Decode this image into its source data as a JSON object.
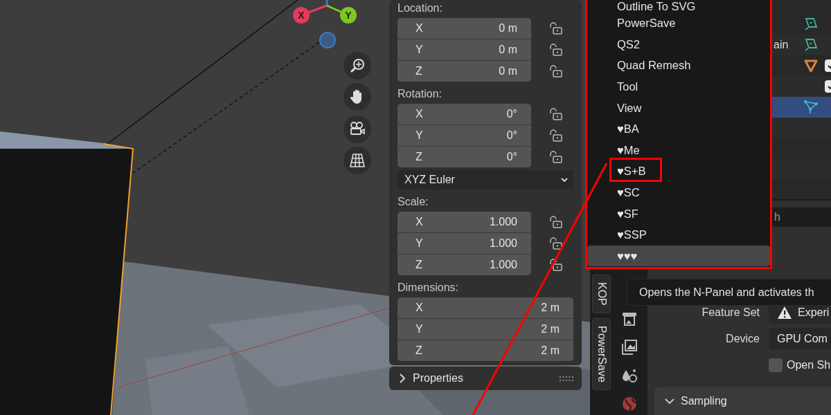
{
  "viewport": {
    "gizmo_axes": [
      {
        "label": "X",
        "color": "#e8395a"
      },
      {
        "label": "Y",
        "color": "#7dc81e"
      }
    ],
    "sidebar_tabs": [
      {
        "label": "KOP",
        "selected": false
      },
      {
        "label": "PowerSave",
        "selected": false
      }
    ]
  },
  "n_panel": {
    "sections": [
      {
        "kind": "vector",
        "label": "Location:",
        "locks": true,
        "fields": [
          {
            "axis": "X",
            "value": "0 m"
          },
          {
            "axis": "Y",
            "value": "0 m"
          },
          {
            "axis": "Z",
            "value": "0 m"
          }
        ]
      },
      {
        "kind": "vector",
        "label": "Rotation:",
        "locks": true,
        "fields": [
          {
            "axis": "X",
            "value": "0°"
          },
          {
            "axis": "Y",
            "value": "0°"
          },
          {
            "axis": "Z",
            "value": "0°"
          }
        ]
      },
      {
        "kind": "dropdown",
        "value": "XYZ Euler"
      },
      {
        "kind": "vector",
        "label": "Scale:",
        "locks": true,
        "fields": [
          {
            "axis": "X",
            "value": "1.000"
          },
          {
            "axis": "Y",
            "value": "1.000"
          },
          {
            "axis": "Z",
            "value": "1.000"
          }
        ]
      },
      {
        "kind": "vector",
        "label": "Dimensions:",
        "locks": false,
        "fields": [
          {
            "axis": "X",
            "value": "2 m"
          },
          {
            "axis": "Y",
            "value": "2 m"
          },
          {
            "axis": "Z",
            "value": "2 m"
          }
        ]
      }
    ],
    "properties_panel": {
      "label": "Properties",
      "expanded": false
    }
  },
  "menu": {
    "items": [
      {
        "label": "Outline To SVG",
        "selected": false
      },
      {
        "label": "PowerSave",
        "selected": false
      },
      {
        "label": "QS2",
        "selected": false
      },
      {
        "label": "Quad Remesh",
        "selected": false
      },
      {
        "label": "Tool",
        "selected": false
      },
      {
        "label": "View",
        "selected": false
      },
      {
        "label": "♥BA",
        "selected": false
      },
      {
        "label": "♥Me",
        "selected": false
      },
      {
        "label": "♥S+B",
        "selected": false
      },
      {
        "label": "♥SC",
        "selected": false
      },
      {
        "label": "♥SF",
        "selected": false
      },
      {
        "label": "♥SSP",
        "selected": false
      },
      {
        "label": "♥♥♥",
        "selected": true
      }
    ]
  },
  "outliner": {
    "rows": [
      {
        "kind": "plane",
        "selected": false
      },
      {
        "kind": "plane",
        "label": "ain",
        "selected": false
      },
      {
        "kind": "cone",
        "checked": true,
        "selected": false
      },
      {
        "kind": "blank",
        "checked": true,
        "selected": false
      },
      {
        "kind": "mesh",
        "selected": true
      }
    ]
  },
  "properties": {
    "search": {
      "placeholder": "h"
    },
    "tooltip": "Opens the N-Panel and activates th",
    "fields": [
      {
        "kind": "dropdown",
        "label": "Feature Set",
        "value": "Experi",
        "warning": true
      },
      {
        "kind": "dropdown",
        "label": "Device",
        "value": "GPU Com"
      },
      {
        "kind": "checkbox",
        "label": "Open Sh",
        "checked": false
      }
    ],
    "panels": [
      {
        "label": "Sampling",
        "expanded": true
      }
    ]
  }
}
